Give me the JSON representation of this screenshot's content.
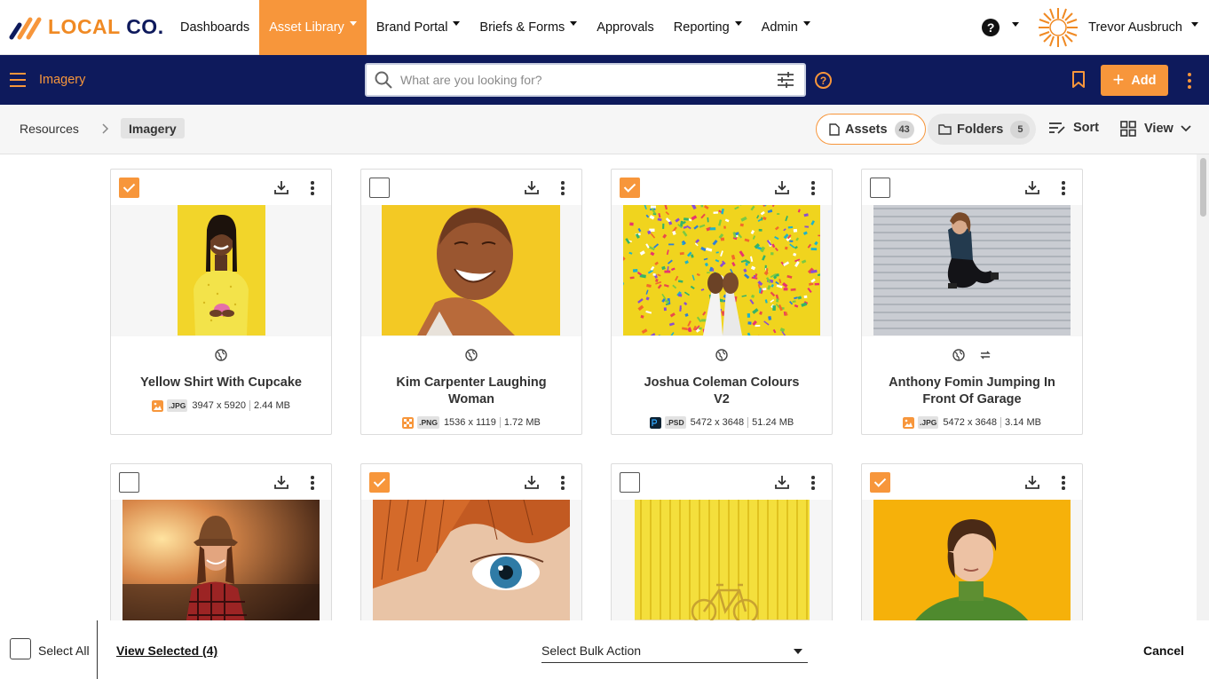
{
  "brand": {
    "name_part1": "LOCAL",
    "name_part2": "CO.",
    "accent": "#f7963b",
    "navy": "#0e1a5c"
  },
  "topnav": {
    "items": [
      {
        "label": "Dashboards"
      },
      {
        "label": "Asset Library",
        "active": true
      },
      {
        "label": "Brand Portal"
      },
      {
        "label": "Briefs & Forms"
      },
      {
        "label": "Approvals"
      },
      {
        "label": "Reporting"
      },
      {
        "label": "Admin"
      }
    ],
    "help_glyph": "?",
    "user_name": "Trevor Ausbruch"
  },
  "toolbar": {
    "section_title": "Imagery",
    "search_placeholder": "What are you looking for?",
    "help_glyph": "?",
    "add_label": "Add"
  },
  "breadcrumb": {
    "root": "Resources",
    "current": "Imagery"
  },
  "tabs": {
    "assets_label": "Assets",
    "assets_count": "43",
    "folders_label": "Folders",
    "folders_count": "5",
    "sort_label": "Sort",
    "view_label": "View"
  },
  "assets": [
    {
      "title": "Yellow Shirt With Cupcake",
      "ext": ".JPG",
      "dims": "3947 x 5920",
      "size": "2.44 MB",
      "selected": true
    },
    {
      "title": "Kim Carpenter Laughing Woman",
      "ext": ".PNG",
      "dims": "1536 x 1119",
      "size": "1.72 MB",
      "selected": false
    },
    {
      "title": "Joshua Coleman Colours V2",
      "ext": ".PSD",
      "dims": "5472 x 3648",
      "size": "51.24 MB",
      "selected": true
    },
    {
      "title": "Anthony Fomin Jumping In Front Of Garage",
      "ext": ".JPG",
      "dims": "5472 x 3648",
      "size": "3.14 MB",
      "selected": false
    },
    {
      "selected": false
    },
    {
      "selected": true
    },
    {
      "selected": false
    },
    {
      "selected": true
    }
  ],
  "bottombar": {
    "select_all": "Select All",
    "view_selected": "View Selected (4)",
    "bulk_action": "Select Bulk Action",
    "cancel": "Cancel"
  }
}
